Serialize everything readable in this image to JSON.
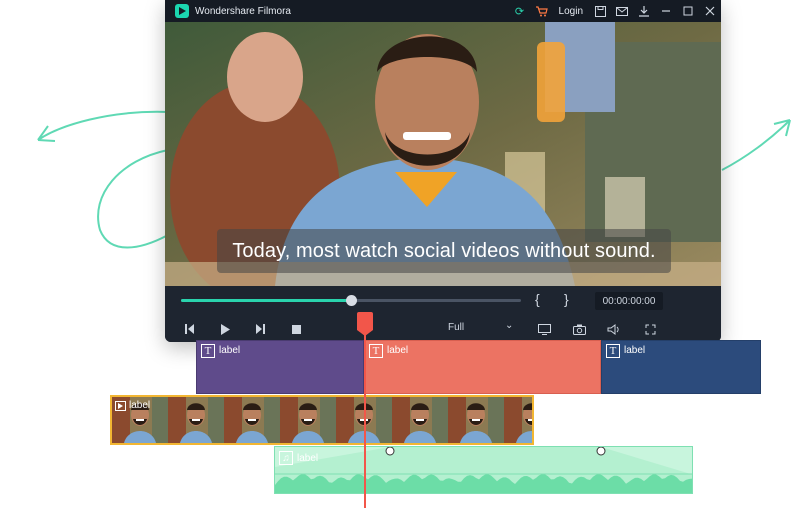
{
  "window": {
    "title": "Wondershare Filmora",
    "login_label": "Login",
    "icons": [
      "sync-icon",
      "cart-icon",
      "save-icon",
      "mail-icon",
      "download-icon",
      "minimize-icon",
      "maximize-icon",
      "close-icon"
    ]
  },
  "preview": {
    "caption": "Today, most watch social videos without sound."
  },
  "controls": {
    "progress_fraction": 0.5,
    "timecode": "00:00:00:00",
    "quality": "Full",
    "brace_open": "{",
    "brace_close": "}"
  },
  "timeline": {
    "text_clips": [
      {
        "label": "label",
        "color": "#5f4b8b"
      },
      {
        "label": "label",
        "color": "#ec7363"
      },
      {
        "label": "label",
        "color": "#2c4b7c"
      }
    ],
    "video_clip": {
      "label": "label",
      "border_color": "#f2b632"
    },
    "audio_clip": {
      "label": "label",
      "color": "#c8f5dd"
    },
    "playhead_color": "#f2564a"
  },
  "colors": {
    "accent": "#2ad3ad",
    "swirl": "#5fd9b4"
  }
}
